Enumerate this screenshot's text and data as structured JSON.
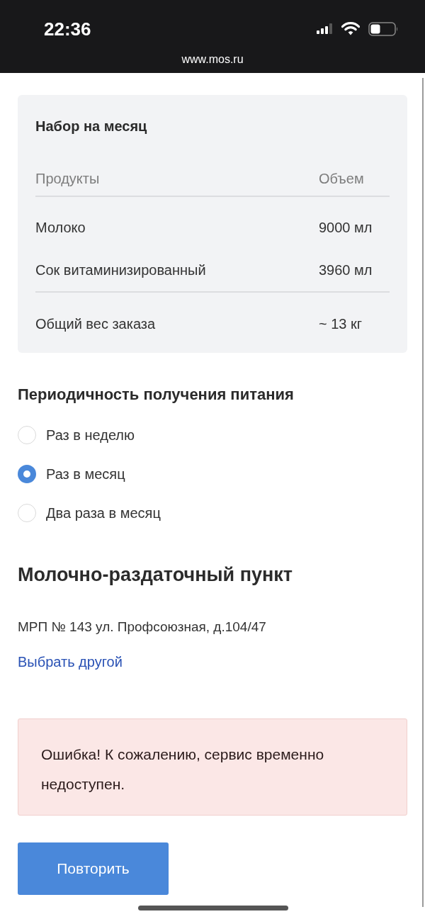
{
  "status_bar": {
    "time": "22:36",
    "url": "www.mos.ru"
  },
  "order_card": {
    "title": "Набор на месяц",
    "columns": [
      "Продукты",
      "Объем"
    ],
    "rows": [
      {
        "product": "Молоко",
        "volume": "9000 мл"
      },
      {
        "product": "Сок витаминизированный",
        "volume": "3960 мл"
      }
    ],
    "total": {
      "label": "Общий вес заказа",
      "value": "~ 13 кг"
    }
  },
  "frequency": {
    "title": "Периодичность получения питания",
    "options": [
      {
        "label": "Раз в неделю",
        "selected": false
      },
      {
        "label": "Раз в месяц",
        "selected": true
      },
      {
        "label": "Два раза в месяц",
        "selected": false
      }
    ]
  },
  "pickup_point": {
    "title": "Молочно-раздаточный пункт",
    "address": "МРП № 143 ул. Профсоюзная, д.104/47",
    "change_link": "Выбрать другой"
  },
  "error": {
    "message": "Ошибка! К сожалению, сервис временно недоступен."
  },
  "retry_button": "Повторить"
}
